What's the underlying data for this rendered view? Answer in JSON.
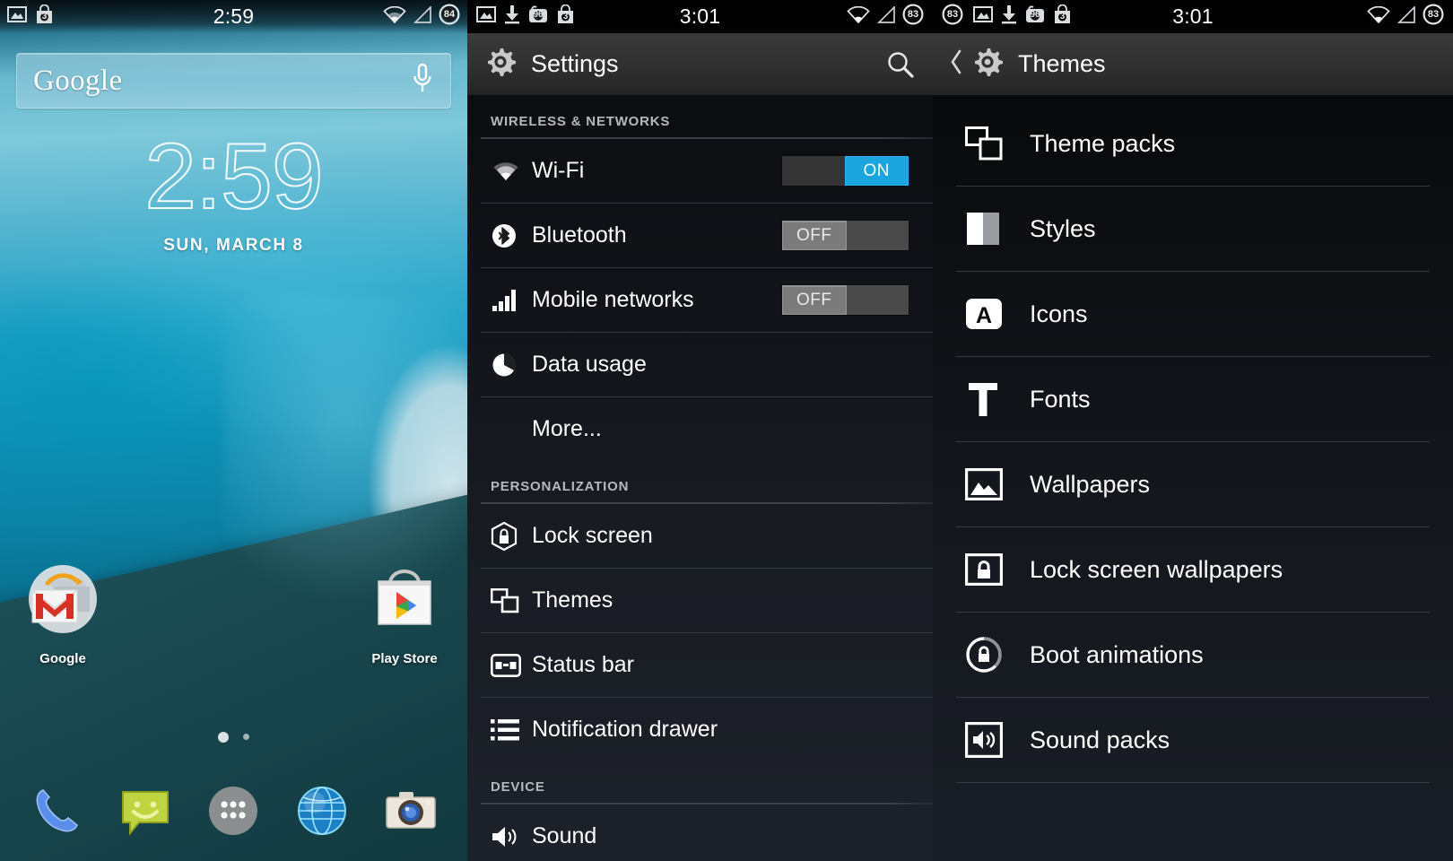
{
  "home": {
    "statusbar": {
      "time": "2:59",
      "left_icons": [
        "image-icon",
        "shopping-bag-icon"
      ],
      "bag_badge": "3",
      "right_icons": [
        "wifi-icon",
        "signal-icon",
        "battery-icon"
      ],
      "battery_level": "84"
    },
    "search": {
      "logo": "Google",
      "mic_icon": "microphone-icon"
    },
    "clock": {
      "time": "2:59",
      "date": "SUN, MARCH 8"
    },
    "apps": [
      {
        "label": "Google",
        "icon": "gmail-folder-icon"
      },
      {
        "label": "Play Store",
        "icon": "play-store-icon"
      }
    ],
    "dock": [
      {
        "icon": "phone-icon",
        "label": "Phone"
      },
      {
        "icon": "messaging-icon",
        "label": "Messaging"
      },
      {
        "icon": "app-drawer-icon",
        "label": "Apps"
      },
      {
        "icon": "browser-icon",
        "label": "Browser"
      },
      {
        "icon": "camera-icon",
        "label": "Camera"
      }
    ],
    "page_dots": 2,
    "active_page": 1
  },
  "settings": {
    "statusbar": {
      "time": "3:01",
      "left_icons": [
        "image-icon",
        "download-icon",
        "piggy-96-icon",
        "shopping-bag-icon"
      ],
      "piggy_badge": "96",
      "bag_badge": "3",
      "battery_level": "83"
    },
    "actionbar": {
      "icon": "gear-icon",
      "title": "Settings",
      "search_icon": "search-icon"
    },
    "groups": [
      {
        "header": "WIRELESS & NETWORKS",
        "items": [
          {
            "label": "Wi-Fi",
            "icon": "wifi-icon",
            "toggle": "ON"
          },
          {
            "label": "Bluetooth",
            "icon": "bluetooth-icon",
            "toggle": "OFF"
          },
          {
            "label": "Mobile networks",
            "icon": "signal-bars-icon",
            "toggle": "OFF"
          },
          {
            "label": "Data usage",
            "icon": "data-usage-icon",
            "toggle": null
          },
          {
            "label": "More...",
            "icon": null,
            "toggle": null
          }
        ]
      },
      {
        "header": "PERSONALIZATION",
        "items": [
          {
            "label": "Lock screen",
            "icon": "lock-hex-icon",
            "toggle": null
          },
          {
            "label": "Themes",
            "icon": "themes-icon",
            "toggle": null
          },
          {
            "label": "Status bar",
            "icon": "status-bar-icon",
            "toggle": null
          },
          {
            "label": "Notification drawer",
            "icon": "list-icon",
            "toggle": null
          }
        ]
      },
      {
        "header": "DEVICE",
        "items": [
          {
            "label": "Sound",
            "icon": "sound-icon",
            "toggle": null
          }
        ]
      }
    ]
  },
  "themes": {
    "statusbar": {
      "time": "3:01",
      "left_icons": [
        "image-icon",
        "download-icon",
        "piggy-96-icon",
        "shopping-bag-icon"
      ],
      "piggy_badge": "96",
      "bag_badge": "3",
      "battery_level": "83"
    },
    "actionbar": {
      "back_icon": "back-chevron-icon",
      "icon": "gear-icon",
      "title": "Themes"
    },
    "items": [
      {
        "label": "Theme packs",
        "icon": "theme-packs-icon"
      },
      {
        "label": "Styles",
        "icon": "styles-icon"
      },
      {
        "label": "Icons",
        "icon": "icons-icon"
      },
      {
        "label": "Fonts",
        "icon": "fonts-icon"
      },
      {
        "label": "Wallpapers",
        "icon": "wallpaper-icon"
      },
      {
        "label": "Lock screen wallpapers",
        "icon": "lock-wallpaper-icon"
      },
      {
        "label": "Boot animations",
        "icon": "boot-animation-icon"
      },
      {
        "label": "Sound packs",
        "icon": "sound-pack-icon"
      }
    ]
  },
  "colors": {
    "accent_blue": "#1ba5de",
    "actionbar": "#303030",
    "toggle_off": "#7b7b7b",
    "panel_dark": "#14171d",
    "divider": "#3d434b",
    "text_primary": "#ffffff",
    "text_group": "#b3b9bd"
  }
}
